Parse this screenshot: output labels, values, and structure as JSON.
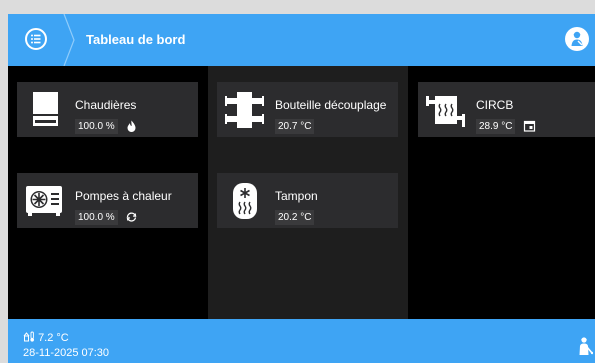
{
  "header": {
    "title": "Tableau de bord",
    "menu_icon": "list-icon",
    "user_icon": "user-worker-icon"
  },
  "tiles": {
    "chaudieres": {
      "name": "Chaudières",
      "value": "100.0 %",
      "status_icon": "flame-icon"
    },
    "pompes": {
      "name": "Pompes à chaleur",
      "value": "100.0 %",
      "status_icon": "cycle-icon"
    },
    "bouteille": {
      "name": "Bouteille découplage",
      "value": "20.7 °C"
    },
    "tampon": {
      "name": "Tampon",
      "value": "20.2 °C"
    },
    "circb": {
      "name": "CIRCB",
      "value": "28.9 °C",
      "status_icon": "calendar-icon"
    }
  },
  "footer": {
    "outdoor_temperature": "7.2 °C",
    "datetime": "28-11-2025 07:30",
    "outdoor_icon": "outdoor-thermometer-icon",
    "user_icon": "user-worker-icon"
  },
  "colors": {
    "accent": "#3ea4f4",
    "tile": "#2c2c2e",
    "value_chip": "#3a3a3c",
    "background": "#000000"
  }
}
